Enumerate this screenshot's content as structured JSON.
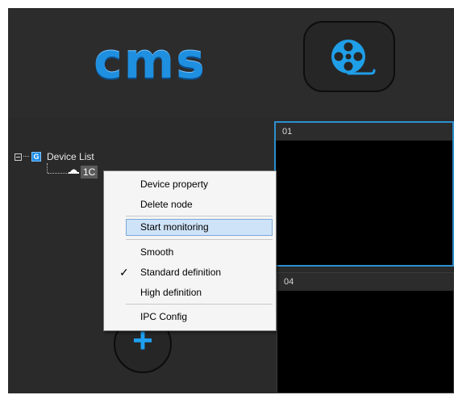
{
  "header": {
    "logo_text": "cms",
    "video_button_icon": "film-reel-icon"
  },
  "tree": {
    "root_label": "Device List",
    "group_icon_letter": "G",
    "device_label": "1C",
    "device_icon": "dome-camera-icon"
  },
  "menu": {
    "items": [
      {
        "label": "Device property"
      },
      {
        "label": "Delete node"
      },
      {
        "label": "Start monitoring"
      },
      {
        "label": "Smooth"
      },
      {
        "label": "Standard definition",
        "checked": true
      },
      {
        "label": "High definition"
      },
      {
        "label": "IPC Config"
      }
    ],
    "check_mark": "✓"
  },
  "grid": {
    "cells": [
      {
        "label": "01"
      },
      {
        "label": "04"
      }
    ]
  },
  "sidebar": {
    "add_button_icon": "plus-icon",
    "add_symbol": "+"
  },
  "colors": {
    "accent": "#1f8fe0",
    "selected_cell_border": "#2e8fd0",
    "menu_highlight": "#cfe3f8",
    "background": "#2a2a2b"
  }
}
